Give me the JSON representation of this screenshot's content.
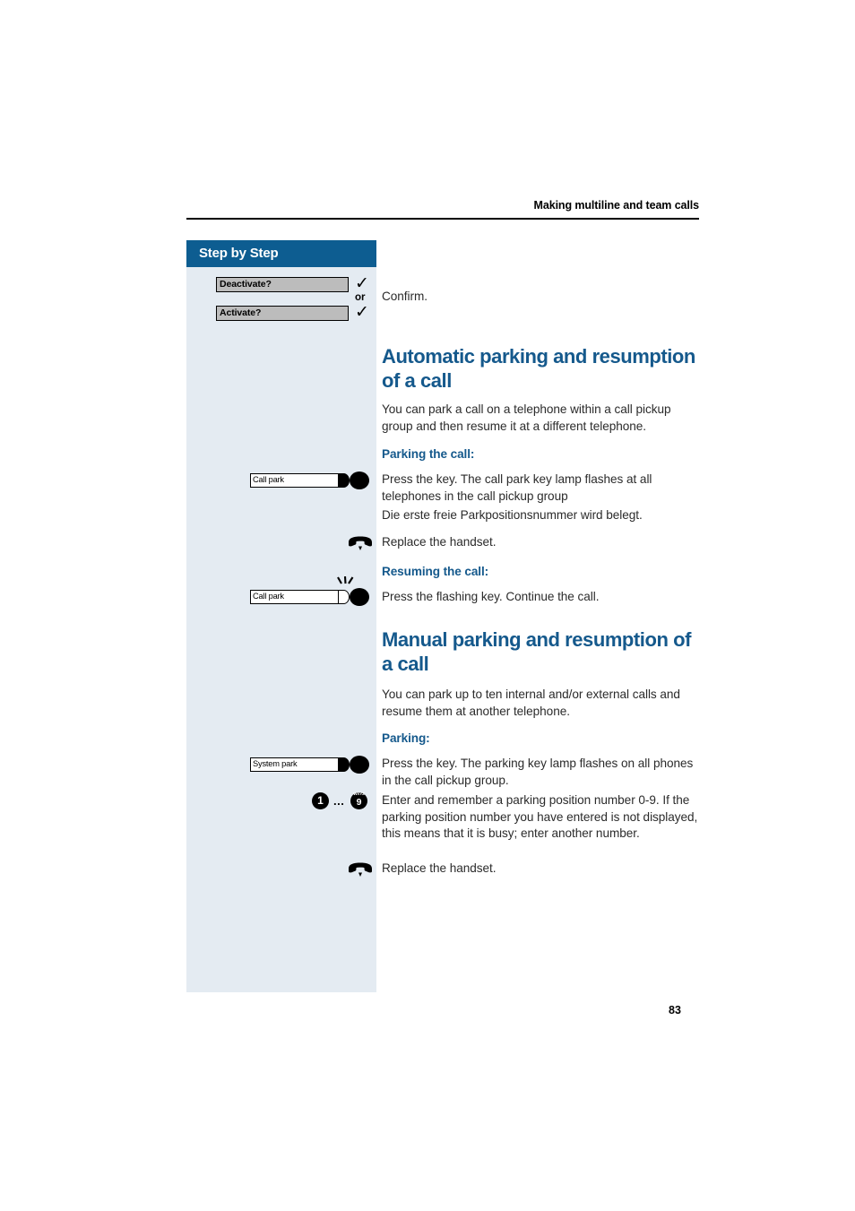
{
  "document": {
    "running_header": "Making multiline and team calls",
    "page_number": "83"
  },
  "sidebar": {
    "title": "Step by Step"
  },
  "colors": {
    "heading_blue": "#15598c",
    "sidebar_title_bar": "#0d5d91",
    "sidebar_body": "#e4ebf2",
    "display_line_fill": "#bcbcbc",
    "body_text": "#2b2b2b"
  },
  "blocks": {
    "confirm_group": {
      "display_option_1": "Deactivate?",
      "display_option_2": "Activate?",
      "or_label": "or",
      "checkmark_glyph": "✓",
      "instruction": "Confirm."
    },
    "automatic_parking": {
      "heading": "Automatic parking and resumption of a call",
      "intro": "You can park a call on a telephone within a call pickup group and then resume it at a different telephone.",
      "subheading_parking": "Parking the call:",
      "key_label_call_park": "Call park",
      "step_press_key": "Press the key. The call park key lamp flashes at all telephones in the call pickup group",
      "step_note_german": "Die erste freie Parkpositionsnummer wird belegt.",
      "step_replace_handset": "Replace the handset.",
      "subheading_resuming": "Resuming the call:",
      "key_label_call_park_flashing": "Call park",
      "step_press_flashing_key": "Press the flashing key. Continue the call."
    },
    "manual_parking": {
      "heading": "Manual parking and resumption of a call",
      "intro": "You can park up to ten internal and/or external calls and resume them at another telephone.",
      "subheading_parking": "Parking:",
      "key_label_system_park": "System park",
      "step_press_key": "Press the key. The parking key lamp flashes on all phones in the call pickup group.",
      "keypad_first": "1",
      "keypad_last": "9",
      "keypad_last_letters": "WXYZ",
      "keypad_ellipsis": "...",
      "step_enter_number": "Enter and remember a parking position number 0-9. If the parking position number you have entered is not displayed, this means that it is busy; enter another number.",
      "step_replace_handset": "Replace the handset."
    }
  }
}
